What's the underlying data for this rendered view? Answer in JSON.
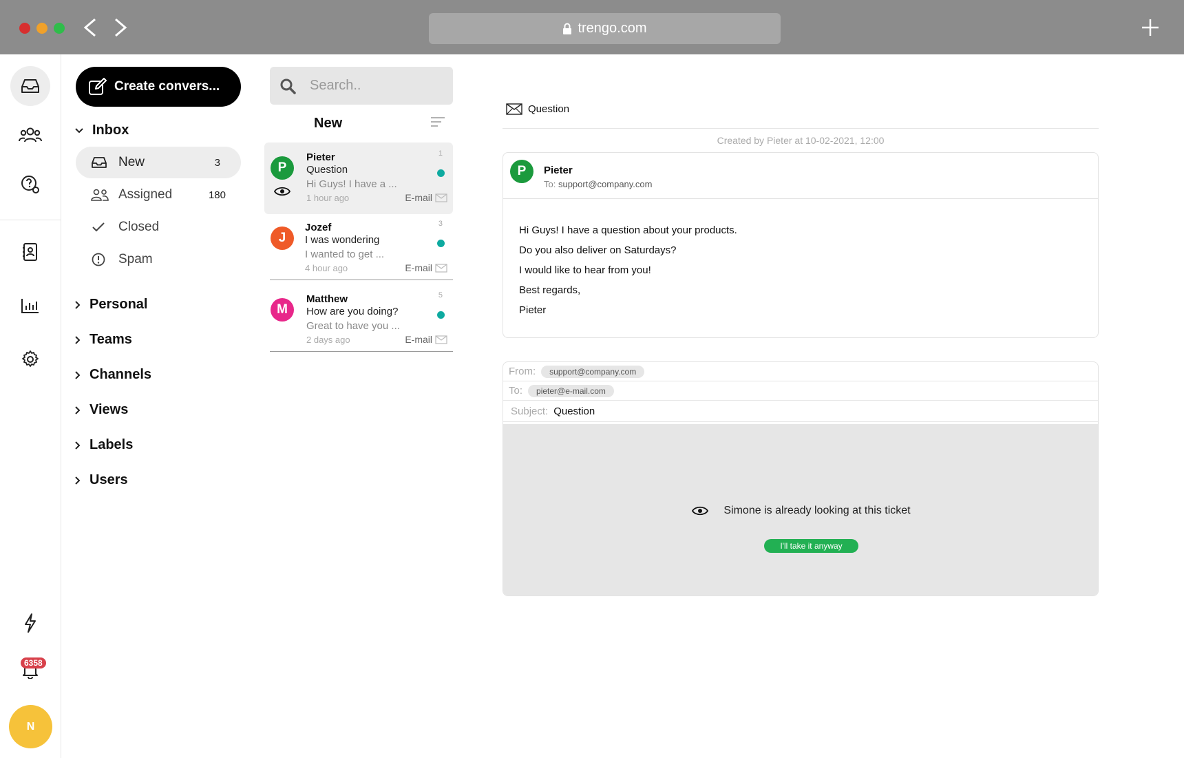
{
  "browser": {
    "url": "trengo.com"
  },
  "rail": {
    "notification_count": "6358",
    "user_initial": "N"
  },
  "sidebar": {
    "create_label": "Create convers...",
    "inbox_label": "Inbox",
    "inbox_items": [
      {
        "label": "New",
        "count": "3"
      },
      {
        "label": "Assigned",
        "count": "180"
      },
      {
        "label": "Closed",
        "count": ""
      },
      {
        "label": "Spam",
        "count": ""
      }
    ],
    "sections": [
      "Personal",
      "Teams",
      "Channels",
      "Views",
      "Labels",
      "Users"
    ]
  },
  "list": {
    "search_placeholder": "Search..",
    "title": "New",
    "conversations": [
      {
        "initial": "P",
        "color": "#1b9a3d",
        "name": "Pieter",
        "subject": "Question",
        "preview": "Hi Guys! I have a ...",
        "time": "1 hour ago",
        "number": "1",
        "channel": "E-mail"
      },
      {
        "initial": "J",
        "color": "#ef5a28",
        "name": "Jozef",
        "subject": "I was wondering",
        "preview": "I wanted to get ...",
        "time": "4 hour ago",
        "number": "3",
        "channel": "E-mail"
      },
      {
        "initial": "M",
        "color": "#e8278a",
        "name": "Matthew",
        "subject": "How are you doing?",
        "preview": "Great to have you ...",
        "time": "2 days ago",
        "number": "5",
        "channel": "E-mail"
      }
    ]
  },
  "detail": {
    "subject": "Question",
    "created": "Created by Pieter at 10-02-2021, 12:00",
    "message": {
      "initial": "P",
      "sender": "Pieter",
      "to_label": "To:",
      "to": "support@company.com",
      "lines": [
        "Hi Guys! I have a question about your products.",
        "Do you also deliver on Saturdays?",
        "I would like to hear from you!",
        "Best regards,",
        "Pieter"
      ]
    },
    "reply": {
      "from_label": "From:",
      "from": "support@company.com",
      "to_label": "To:",
      "to": "pieter@e-mail.com",
      "subject_label": "Subject:",
      "subject": "Question",
      "lock_message": "Simone is already looking at this ticket",
      "take_button": "I'll take it anyway"
    }
  }
}
